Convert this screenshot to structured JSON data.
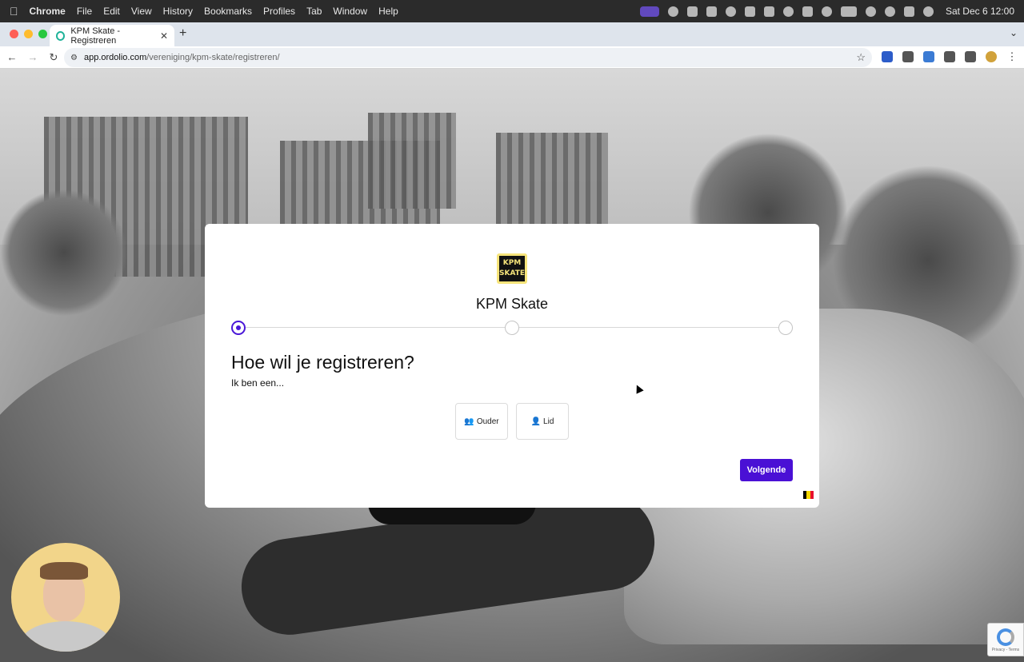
{
  "menubar": {
    "app": "Chrome",
    "items": [
      "File",
      "Edit",
      "View",
      "History",
      "Bookmarks",
      "Profiles",
      "Tab",
      "Window",
      "Help"
    ],
    "clock": "Sat Dec 6  12:00"
  },
  "browser": {
    "tab_title": "KPM Skate - Registreren",
    "url_host": "app.ordolio.com",
    "url_path": "/vereniging/kpm-skate/registreren/"
  },
  "modal": {
    "logo_text_top": "KPM",
    "logo_text_bottom": "SKATE",
    "org_name": "KPM Skate",
    "steps_total": 3,
    "current_step": 1,
    "heading": "Hoe wil je registreren?",
    "subheading": "Ik ben een...",
    "options": [
      {
        "label": "Ouder",
        "icon": "users-icon"
      },
      {
        "label": "Lid",
        "icon": "person-icon"
      }
    ],
    "next_label": "Volgende",
    "language_flag": "belgium-flag-icon",
    "flag_colors": [
      "#000000",
      "#f6d600",
      "#e8112d"
    ],
    "accent_color": "#4a10d5"
  },
  "recaptcha": {
    "terms_text": "Privacy - Terms"
  }
}
